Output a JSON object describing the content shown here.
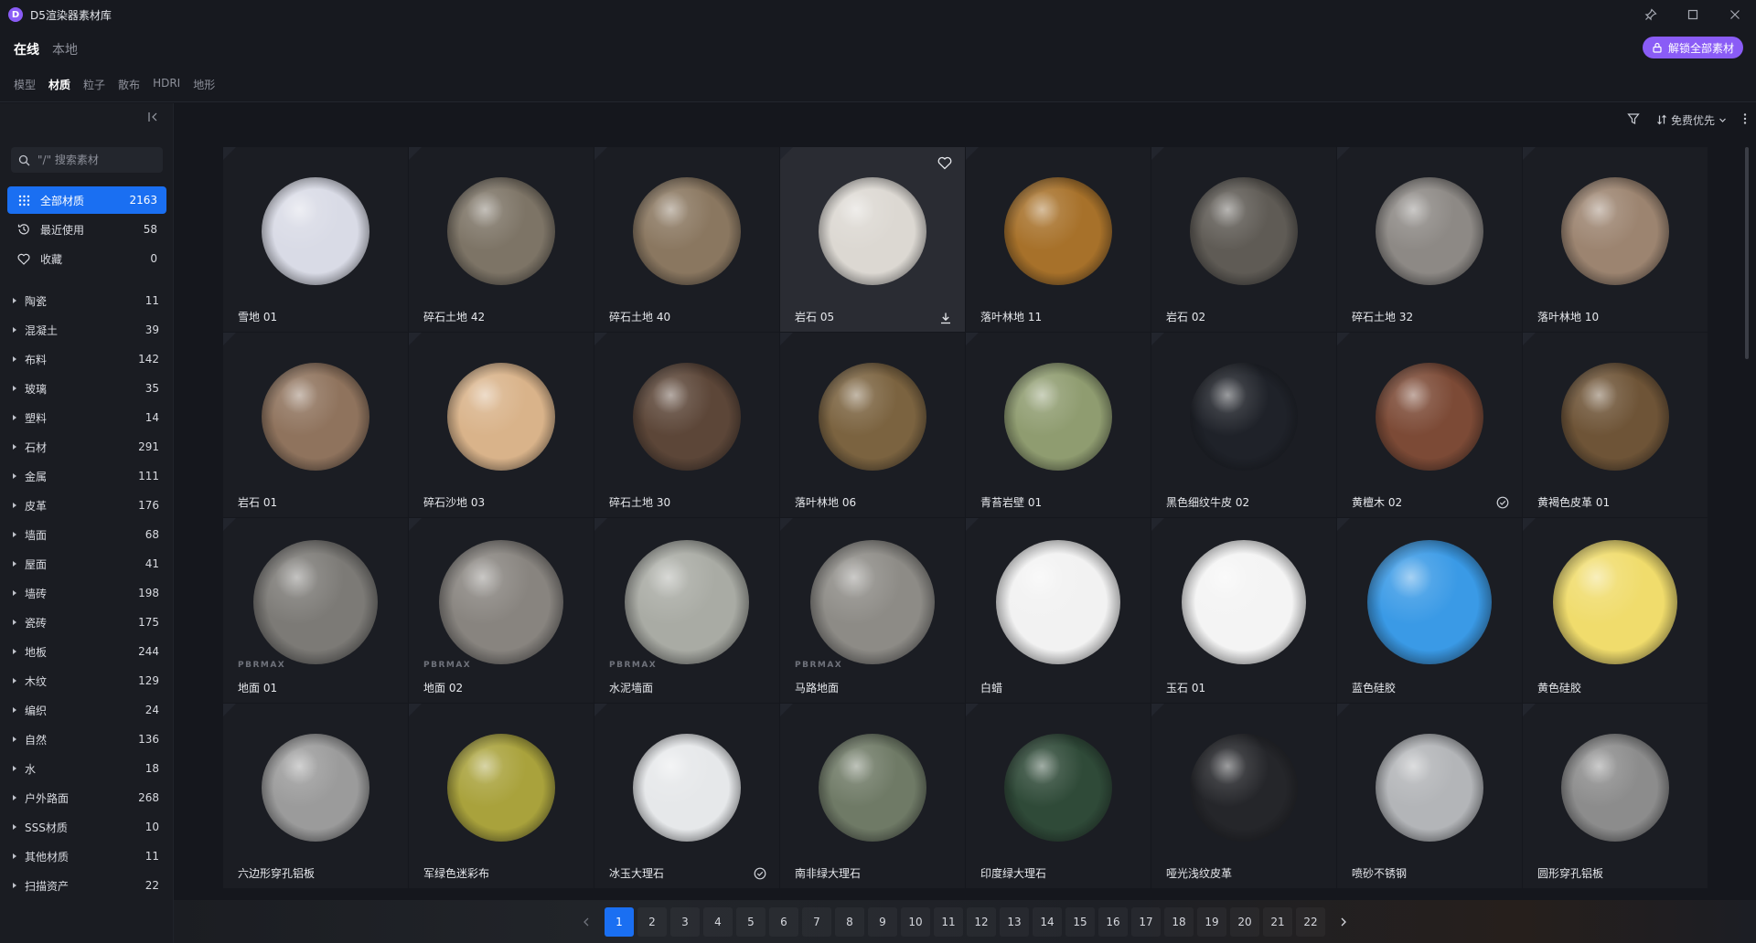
{
  "window": {
    "title": "D5渲染器素材库",
    "logo_letter": "D"
  },
  "mode_tabs": [
    {
      "label": "在线",
      "active": true
    },
    {
      "label": "本地",
      "active": false
    }
  ],
  "category_tabs": [
    {
      "label": "模型",
      "active": false
    },
    {
      "label": "材质",
      "active": true
    },
    {
      "label": "粒子",
      "active": false
    },
    {
      "label": "散布",
      "active": false
    },
    {
      "label": "HDRI",
      "active": false
    },
    {
      "label": "地形",
      "active": false
    }
  ],
  "unlock_button": "解锁全部素材",
  "search": {
    "placeholder": "\"/\" 搜索素材"
  },
  "quick_items": [
    {
      "label": "全部材质",
      "count": "2163",
      "icon": "grid-icon",
      "active": true
    },
    {
      "label": "最近使用",
      "count": "58",
      "icon": "history-icon",
      "active": false
    },
    {
      "label": "收藏",
      "count": "0",
      "icon": "heart-icon",
      "active": false
    }
  ],
  "categories": [
    {
      "label": "陶瓷",
      "count": "11"
    },
    {
      "label": "混凝土",
      "count": "39"
    },
    {
      "label": "布料",
      "count": "142"
    },
    {
      "label": "玻璃",
      "count": "35"
    },
    {
      "label": "塑料",
      "count": "14"
    },
    {
      "label": "石材",
      "count": "291"
    },
    {
      "label": "金属",
      "count": "111"
    },
    {
      "label": "皮革",
      "count": "176"
    },
    {
      "label": "墙面",
      "count": "68"
    },
    {
      "label": "屋面",
      "count": "41"
    },
    {
      "label": "墙砖",
      "count": "198"
    },
    {
      "label": "瓷砖",
      "count": "175"
    },
    {
      "label": "地板",
      "count": "244"
    },
    {
      "label": "木纹",
      "count": "129"
    },
    {
      "label": "编织",
      "count": "24"
    },
    {
      "label": "自然",
      "count": "136"
    },
    {
      "label": "水",
      "count": "18"
    },
    {
      "label": "户外路面",
      "count": "268"
    },
    {
      "label": "SSS材质",
      "count": "10"
    },
    {
      "label": "其他材质",
      "count": "11"
    },
    {
      "label": "扫描资产",
      "count": "22"
    }
  ],
  "toolbar": {
    "sort_label": "免费优先"
  },
  "materials": [
    {
      "name": "雪地 01",
      "color": "#d9dbe6"
    },
    {
      "name": "碎石土地 42",
      "color": "#7d7466"
    },
    {
      "name": "碎石土地 40",
      "color": "#8a7760"
    },
    {
      "name": "岩石 05",
      "color": "#dcd8d2",
      "hover": true
    },
    {
      "name": "落叶林地 11",
      "color": "#a7712a"
    },
    {
      "name": "岩石 02",
      "color": "#5f5b55"
    },
    {
      "name": "碎石土地 32",
      "color": "#8d8985"
    },
    {
      "name": "落叶林地 10",
      "color": "#9c8470"
    },
    {
      "name": "岩石 01",
      "color": "#8f735d"
    },
    {
      "name": "碎石沙地 03",
      "color": "#d9b38a"
    },
    {
      "name": "碎石土地 30",
      "color": "#5c4638"
    },
    {
      "name": "落叶林地 06",
      "color": "#7b6340"
    },
    {
      "name": "青苔岩壁 01",
      "color": "#8f9c70"
    },
    {
      "name": "黑色细纹牛皮 02",
      "color": "#1f2229"
    },
    {
      "name": "黄檀木 02",
      "color": "#7c4a36",
      "check": true
    },
    {
      "name": "黄褐色皮革 01",
      "color": "#6e5437"
    },
    {
      "name": "地面 01",
      "color": "#7c7a76",
      "brand": "PBRMAX",
      "big": true
    },
    {
      "name": "地面 02",
      "color": "#88847f",
      "brand": "PBRMAX",
      "big": true
    },
    {
      "name": "水泥墙面",
      "color": "#a9aba4",
      "brand": "PBRMAX",
      "big": true
    },
    {
      "name": "马路地面",
      "color": "#8d8b86",
      "brand": "PBRMAX",
      "big": true
    },
    {
      "name": "白蜡",
      "color": "#f2f2f2",
      "big": true
    },
    {
      "name": "玉石 01",
      "color": "#f4f4f4",
      "big": true
    },
    {
      "name": "蓝色硅胶",
      "color": "#3a9ae6",
      "big": true
    },
    {
      "name": "黄色硅胶",
      "color": "#f0dc6c",
      "big": true
    },
    {
      "name": "六边形穿孔铝板",
      "color": "#9b9b9b"
    },
    {
      "name": "军绿色迷彩布",
      "color": "#a9a23c"
    },
    {
      "name": "冰玉大理石",
      "color": "#e6e8ea",
      "check": true
    },
    {
      "name": "南非绿大理石",
      "color": "#6f7a66"
    },
    {
      "name": "印度绿大理石",
      "color": "#2f4a38"
    },
    {
      "name": "哑光浅纹皮革",
      "color": "#25262a"
    },
    {
      "name": "喷砂不锈钢",
      "color": "#b3b5b8"
    },
    {
      "name": "圆形穿孔铝板",
      "color": "#8c8c8c"
    }
  ],
  "pager": {
    "pages": [
      "1",
      "2",
      "3",
      "4",
      "5",
      "6",
      "7",
      "8",
      "9",
      "10",
      "11",
      "12",
      "13",
      "14",
      "15",
      "16",
      "17",
      "18",
      "19",
      "20",
      "21",
      "22"
    ],
    "current": "1"
  },
  "colors": {
    "accent": "#1a6ff2",
    "brand_purple": "#8a5cf6"
  }
}
